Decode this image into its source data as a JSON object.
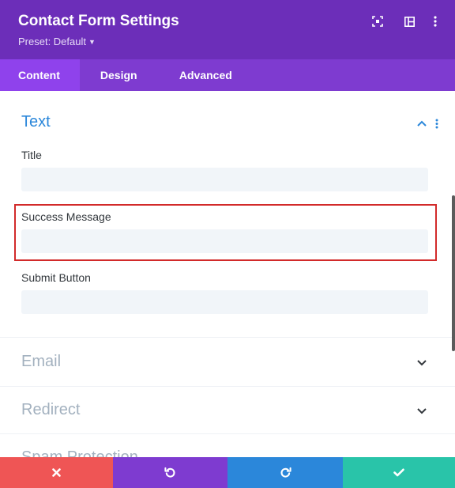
{
  "header": {
    "title": "Contact Form Settings",
    "preset_label": "Preset: Default",
    "icons": [
      "focus-icon",
      "split-view-icon",
      "more-vertical-icon"
    ]
  },
  "tabs": [
    {
      "label": "Content",
      "active": true
    },
    {
      "label": "Design",
      "active": false
    },
    {
      "label": "Advanced",
      "active": false
    }
  ],
  "text_section": {
    "title": "Text",
    "fields": [
      {
        "label": "Title",
        "value": ""
      },
      {
        "label": "Success Message",
        "value": ""
      },
      {
        "label": "Submit Button",
        "value": ""
      }
    ]
  },
  "collapsed_sections": [
    "Email",
    "Redirect",
    "Spam Protection"
  ],
  "footer": {
    "buttons": [
      "discard-icon",
      "undo-icon",
      "redo-icon",
      "save-icon"
    ]
  },
  "colors": {
    "header_bg": "#6c2eb9",
    "tabs_bg": "#7e3bd0",
    "active_tab_bg": "#8f42ec",
    "accent_blue": "#2b87da",
    "discard": "#ef5555",
    "undo": "#7e3bd0",
    "redo": "#2b87da",
    "save": "#29c4a9",
    "highlight": "#d22a2a"
  }
}
